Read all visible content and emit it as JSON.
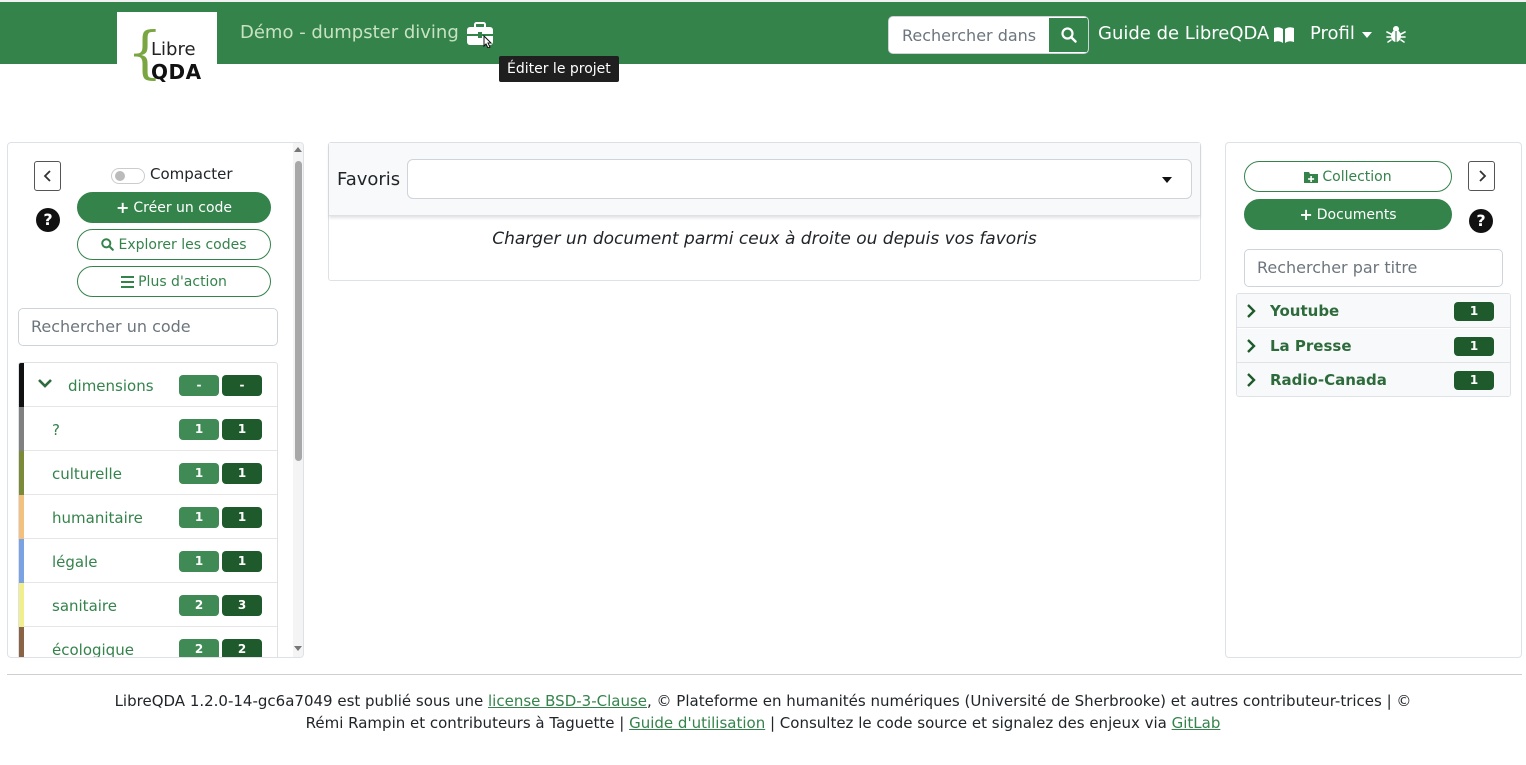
{
  "header": {
    "logo": {
      "line1": "Libre",
      "line2": "QDA"
    },
    "project_title": "Démo - dumpster diving",
    "edit_tooltip": "Éditer le projet",
    "search": {
      "placeholder": "Rechercher dans"
    },
    "guide_label": "Guide de LibreQDA",
    "profile_label": "Profil",
    "colors": {
      "bg": "#34834b",
      "title": "#c8e2c3"
    }
  },
  "left_panel": {
    "compact_label": "Compacter",
    "create_code_label": "Créer un code",
    "explore_codes_label": "Explorer les codes",
    "more_actions_label": "Plus d'action",
    "code_search_placeholder": "Rechercher un code",
    "codes": [
      {
        "name": "dimensions",
        "count_a": "-",
        "count_b": "-",
        "color": "#111111",
        "expanded": true
      },
      {
        "name": "?",
        "count_a": "1",
        "count_b": "1",
        "color": "#808080"
      },
      {
        "name": "culturelle",
        "count_a": "1",
        "count_b": "1",
        "color": "#7b8a36"
      },
      {
        "name": "humanitaire",
        "count_a": "1",
        "count_b": "1",
        "color": "#f4c07d"
      },
      {
        "name": "légale",
        "count_a": "1",
        "count_b": "1",
        "color": "#7ba3e3"
      },
      {
        "name": "sanitaire",
        "count_a": "2",
        "count_b": "3",
        "color": "#f1ee8e"
      },
      {
        "name": "écologique",
        "count_a": "2",
        "count_b": "2",
        "color": "#8a6244"
      }
    ]
  },
  "center": {
    "favorites_label": "Favoris",
    "favorites_value": "",
    "message": "Charger un document parmi ceux à droite ou depuis vos favoris"
  },
  "right_panel": {
    "collection_label": "Collection",
    "documents_label": "Documents",
    "title_search_placeholder": "Rechercher par titre",
    "documents": [
      {
        "title": "Youtube",
        "count": "1"
      },
      {
        "title": "La Presse",
        "count": "1"
      },
      {
        "title": "Radio-Canada",
        "count": "1"
      }
    ]
  },
  "footer": {
    "text1": "LibreQDA 1.2.0-14-gc6a7049 est publié sous une ",
    "license_link": "license BSD-3-Clause",
    "text2": ", © Plateforme en humanités numériques (Université de Sherbrooke) et autres contributeur-trices | © Rémi Rampin et contributeurs à Taguette | ",
    "guide_link": "Guide d'utilisation",
    "text3": " | Consultez le code source et signalez des enjeux via ",
    "gitlab_link": "GitLab"
  }
}
